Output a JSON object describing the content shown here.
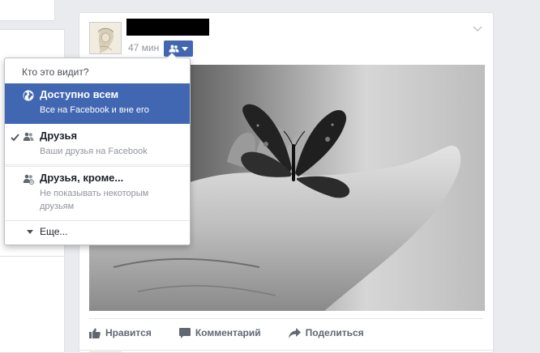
{
  "post": {
    "timestamp": "47 мин",
    "audience_icon": "friends-icon"
  },
  "privacy_menu": {
    "header": "Кто это видит?",
    "options": [
      {
        "title": "Доступно всем",
        "subtitle": "Все на Facebook и вне его",
        "icon": "globe-icon",
        "highlighted": true
      },
      {
        "title": "Друзья",
        "subtitle": "Ваши друзья на Facebook",
        "icon": "friends-icon",
        "selected": true
      },
      {
        "title": "Друзья, кроме...",
        "subtitle": "Не показывать некоторым друзьям",
        "icon": "friends-except-icon"
      }
    ],
    "more_label": "Еще..."
  },
  "actions": {
    "like": "Нравится",
    "comment": "Комментарий",
    "share": "Поделиться"
  },
  "colors": {
    "accent": "#4267b2",
    "background": "#e9ebee",
    "action_text": "#606770"
  }
}
